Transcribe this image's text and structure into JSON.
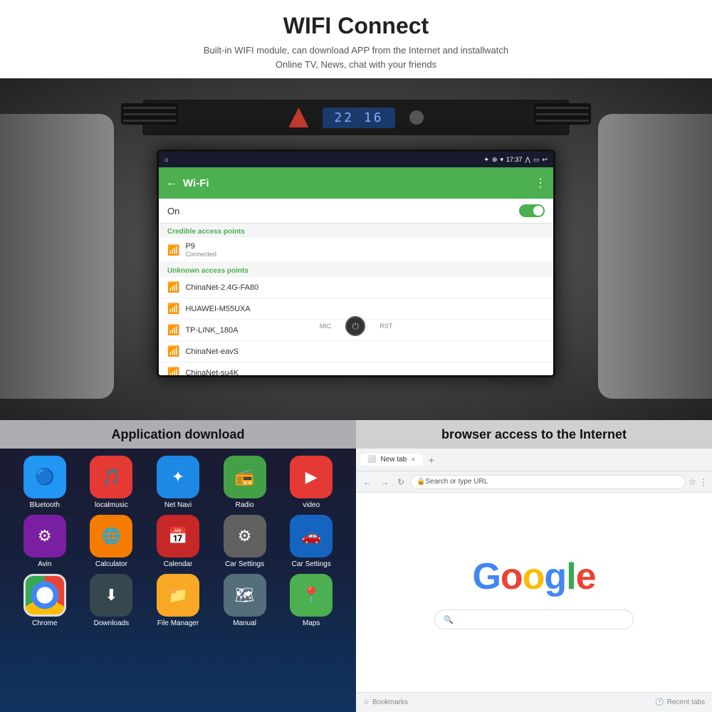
{
  "header": {
    "title": "WIFI Connect",
    "description_line1": "Built-in WIFI module, can download APP from the Internet and installwatch",
    "description_line2": "Online TV, News, chat with your friends"
  },
  "car_screen": {
    "clock": "22 16",
    "statusbar": {
      "time": "17:37",
      "icons": [
        "home",
        "bluetooth",
        "wifi",
        "signal",
        "expand",
        "battery",
        "back"
      ]
    },
    "wifi": {
      "title": "Wi-Fi",
      "toggle_label": "On",
      "sections": {
        "credible": "Credible access points",
        "unknown": "Unknown access points"
      },
      "networks": [
        {
          "name": "P9",
          "sub": "Connected",
          "type": "credible"
        },
        {
          "name": "ChinaNet-2.4G-FA80",
          "sub": "",
          "type": "unknown"
        },
        {
          "name": "HUAWEI-M55UXA",
          "sub": "",
          "type": "unknown"
        },
        {
          "name": "TP-LINK_180A",
          "sub": "",
          "type": "unknown"
        },
        {
          "name": "ChinaNet-eavS",
          "sub": "",
          "type": "unknown"
        },
        {
          "name": "ChinaNet-su4K",
          "sub": "",
          "type": "unknown"
        }
      ]
    },
    "buttons": [
      "MIC",
      "PWR",
      "RST"
    ]
  },
  "bottom": {
    "label_left": "Application download",
    "label_right": "browser access to the Internet",
    "apps": [
      {
        "name": "Bluetooth",
        "color": "#2196F3",
        "icon": "🔵"
      },
      {
        "name": "localmusic",
        "color": "#e53935",
        "icon": "🎵"
      },
      {
        "name": "Net Navi",
        "color": "#1e88e5",
        "icon": "✦"
      },
      {
        "name": "Radio",
        "color": "#43a047",
        "icon": "📻"
      },
      {
        "name": "video",
        "color": "#e53935",
        "icon": "▶"
      },
      {
        "name": "Avin",
        "color": "#7b1fa2",
        "icon": "⚙"
      },
      {
        "name": "Calculator",
        "color": "#f57c00",
        "icon": "🌐"
      },
      {
        "name": "Calendar",
        "color": "#c62828",
        "icon": "📅"
      },
      {
        "name": "Car Settings",
        "color": "#616161",
        "icon": "⚙"
      },
      {
        "name": "Car Settings",
        "color": "#1565c0",
        "icon": "🚗"
      },
      {
        "name": "Chrome",
        "color": "#f57c00",
        "icon": "◉"
      },
      {
        "name": "Downloads",
        "color": "#37474f",
        "icon": "⬇"
      },
      {
        "name": "File Manager",
        "color": "#f9a825",
        "icon": "📁"
      },
      {
        "name": "Manual",
        "color": "#546e7a",
        "icon": "🗺"
      },
      {
        "name": "Maps",
        "color": "#4caf50",
        "icon": "📍"
      }
    ],
    "browser": {
      "tab_title": "New tab",
      "url_placeholder": "Search or type URL",
      "google_text": "Google",
      "bookmarks_label": "Bookmarks",
      "recent_tabs_label": "Recent tabs"
    }
  }
}
